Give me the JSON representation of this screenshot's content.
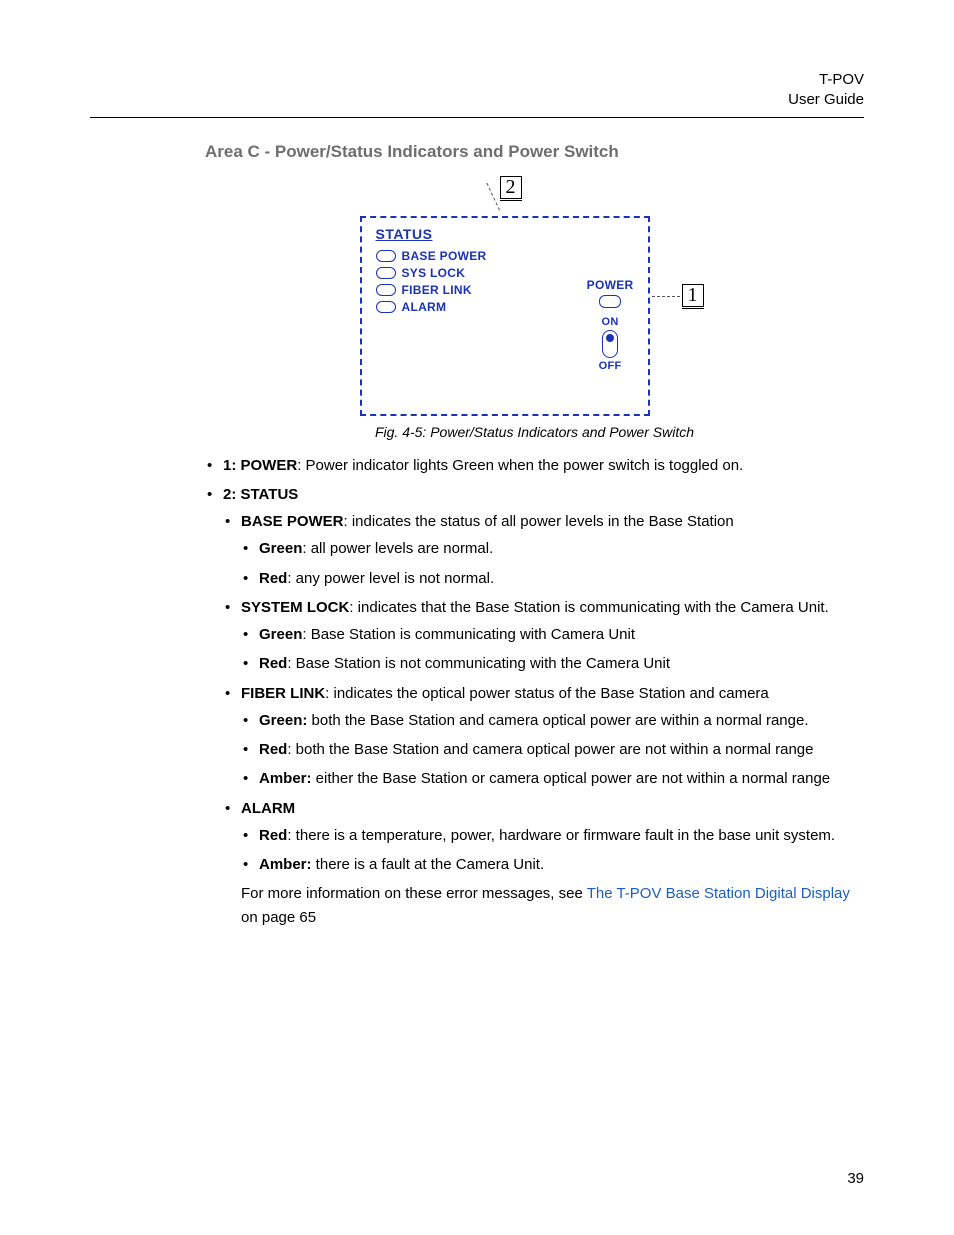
{
  "header": {
    "product": "T-POV",
    "doc": "User Guide"
  },
  "section_title": "Area C - Power/Status Indicators and Power Switch",
  "diagram": {
    "status_label": "STATUS",
    "leds": [
      "BASE POWER",
      "SYS LOCK",
      "FIBER LINK",
      "ALARM"
    ],
    "power_label": "POWER",
    "on": "ON",
    "off": "OFF",
    "callout_1": "1",
    "callout_2": "2"
  },
  "figcap": "Fig. 4-5: Power/Status Indicators and Power Switch",
  "b1": {
    "label": "1: POWER",
    "text": ": Power indicator lights Green when the power switch is toggled on."
  },
  "b2": {
    "label": "2: STATUS",
    "base_power": {
      "label": "BASE POWER",
      "text": ": indicates the status of all power levels in the Base Station",
      "green_l": "Green",
      "green_t": ": all power levels are normal.",
      "red_l": "Red",
      "red_t": ": any power level is not normal."
    },
    "system_lock": {
      "label": "SYSTEM LOCK",
      "text": ": indicates that the Base Station is communicating with the Camera Unit.",
      "green_l": "Green",
      "green_t": ": Base Station is communicating with Camera Unit",
      "red_l": "Red",
      "red_t": ": Base Station is not communicating with the Camera Unit"
    },
    "fiber_link": {
      "label": "FIBER LINK",
      "text": ": indicates the optical power status of the Base Station and camera",
      "green_l": "Green:",
      "green_t": " both the Base Station and camera optical power are within a normal range.",
      "red_l": "Red",
      "red_t": ": both the Base Station and camera optical power are not within a normal range",
      "amber_l": "Amber:",
      "amber_t": " either the Base Station or camera optical power are not within a normal range"
    },
    "alarm": {
      "label": "ALARM",
      "red_l": "Red",
      "red_t": ": there is a temperature, power, hardware or firmware fault in the base unit system.",
      "amber_l": "Amber:",
      "amber_t": " there is a fault at the Camera Unit."
    },
    "footer_pre": "For more information on these error messages, see ",
    "footer_link": "The T-POV Base Station Digital Display",
    "footer_post": " on page 65"
  },
  "pagenum": "39"
}
